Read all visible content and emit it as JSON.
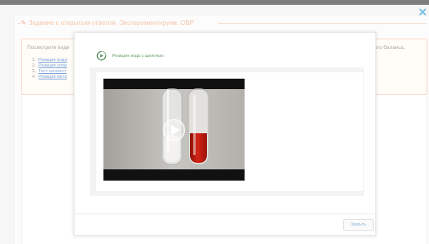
{
  "header": {
    "title": "Задание с открытым ответом. Экспериментируем. ОВР",
    "close_label": "✕"
  },
  "task": {
    "intro_left": "Посмотрите виде",
    "intro_right": "ого баланса.",
    "items": [
      {
        "num": "1.",
        "label": "Реакция иода"
      },
      {
        "num": "2.",
        "label": "Реакция хлор"
      },
      {
        "num": "3.",
        "label": "Тест на восст"
      },
      {
        "num": "4.",
        "label": "Реакция мета"
      }
    ]
  },
  "modal": {
    "title": "Реакция иода с щелочью",
    "close_button": "Закрыть"
  },
  "colors": {
    "accent_blue": "#2f9fd8",
    "header_orange": "#f0a87c",
    "modal_title_green": "#6a9c6a",
    "red_solution": "#c51a0f"
  }
}
